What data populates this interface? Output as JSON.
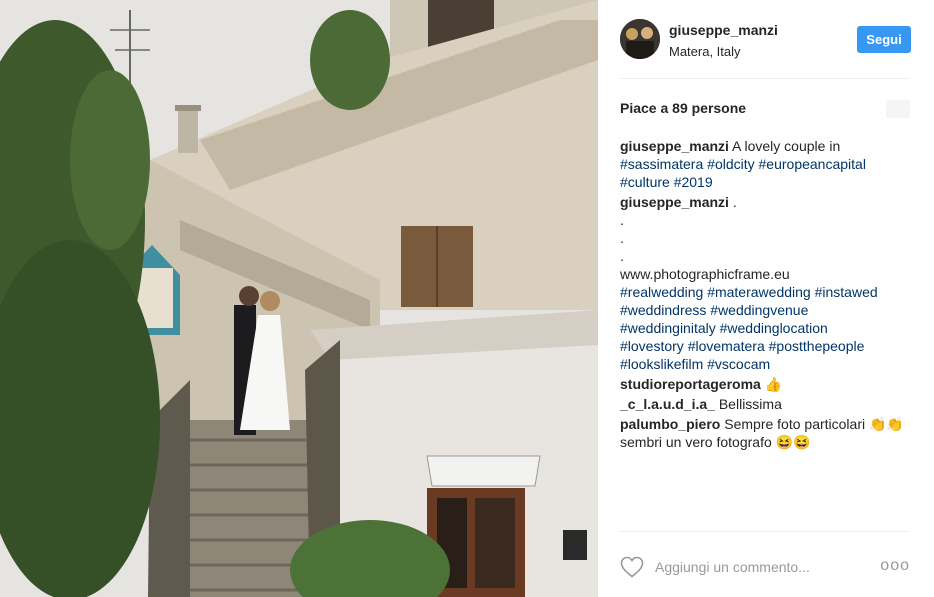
{
  "header": {
    "username": "giuseppe_manzi",
    "location": "Matera, Italy",
    "follow_label": "Segui"
  },
  "likes": {
    "text": "Piace a 89 persone"
  },
  "comments": [
    {
      "user": "giuseppe_manzi",
      "text": "A lovely couple in",
      "tags": [
        "#sassimatera",
        "#oldcity",
        "#europeancapital",
        "#culture",
        "#2019"
      ]
    },
    {
      "user": "giuseppe_manzi",
      "text": ".",
      "lines": [
        ".",
        ".",
        ".",
        "www.photographicframe.eu"
      ],
      "tags": [
        "#realwedding",
        "#materawedding",
        "#instawed",
        "#weddindress",
        "#weddingvenue",
        "#weddinginitaly",
        "#weddinglocation",
        "#lovestory",
        "#lovematera",
        "#postthepeople",
        "#lookslikefilm",
        "#vscocam"
      ]
    },
    {
      "user": "studioreportageroma",
      "text": "👍"
    },
    {
      "user": "_c_l.a.u.d_i.a_",
      "text": "Bellissima"
    },
    {
      "user": "palumbo_piero",
      "text": "Sempre foto particolari 👏👏sembri un vero fotografo 😆😆"
    }
  ],
  "footer": {
    "comment_placeholder": "Aggiungi un commento...",
    "more_label": "ooo"
  },
  "colors": {
    "follow_button": "#3897f0",
    "hashtag": "#003569",
    "text": "#262626",
    "muted": "#999999"
  },
  "icons": {
    "like": "heart-outline-icon",
    "more": "more-options-icon"
  }
}
